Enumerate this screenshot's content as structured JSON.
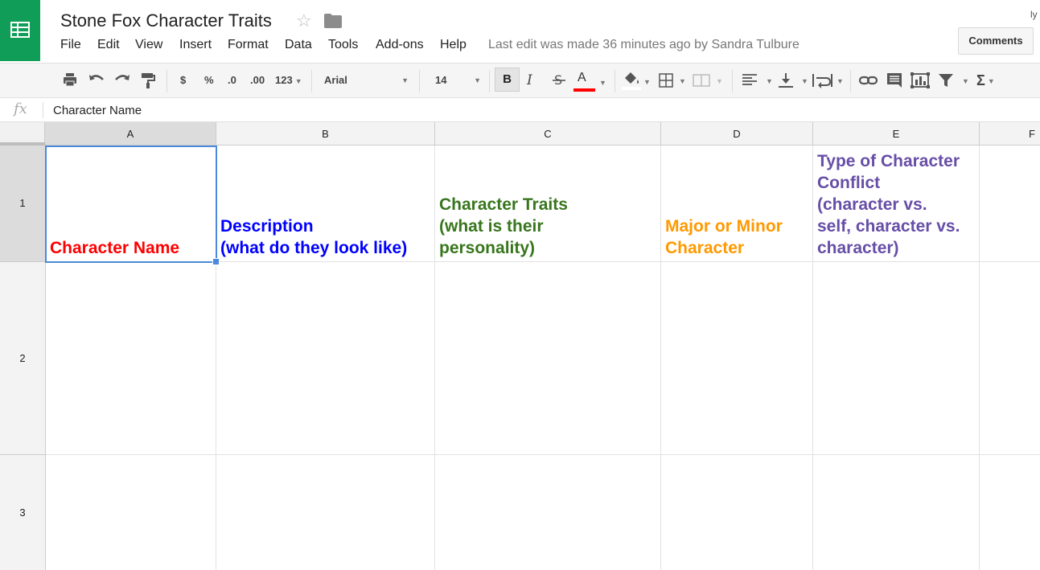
{
  "document": {
    "title": "Stone Fox Character Traits",
    "last_edit": "Last edit was made 36 minutes ago by Sandra Tulbure",
    "user_initials": "ly",
    "comments_label": "Comments"
  },
  "menu": [
    "File",
    "Edit",
    "View",
    "Insert",
    "Format",
    "Data",
    "Tools",
    "Add-ons",
    "Help"
  ],
  "toolbar": {
    "currency": "$",
    "percent": "%",
    "decrease_decimal": ".0",
    "increase_decimal": ".00",
    "more_formats": "123",
    "font": "Arial",
    "font_size": "14",
    "bold": "B",
    "italic": "I",
    "text_color_label": "A",
    "text_color": "#ff0000",
    "sum": "Σ"
  },
  "formula_bar": {
    "fx": "fx",
    "value": "Character Name"
  },
  "grid": {
    "columns": [
      "A",
      "B",
      "C",
      "D",
      "E",
      "F"
    ],
    "rows": [
      "1",
      "2",
      "3"
    ],
    "selected_cell": "A1",
    "row1": [
      {
        "lines": [
          "Character Name"
        ],
        "color": "#ff0000"
      },
      {
        "lines": [
          "Description",
          "(what do they look like)"
        ],
        "color": "#0000ff"
      },
      {
        "lines": [
          "Character Traits",
          "(what is their",
          "personality)"
        ],
        "color": "#38761d"
      },
      {
        "lines": [
          "Major or Minor",
          "Character"
        ],
        "color": "#ff9900"
      },
      {
        "lines": [
          "Type of Character",
          "Conflict",
          "(character vs.",
          "self, character vs.",
          "character)"
        ],
        "color": "#674ea7"
      }
    ]
  }
}
